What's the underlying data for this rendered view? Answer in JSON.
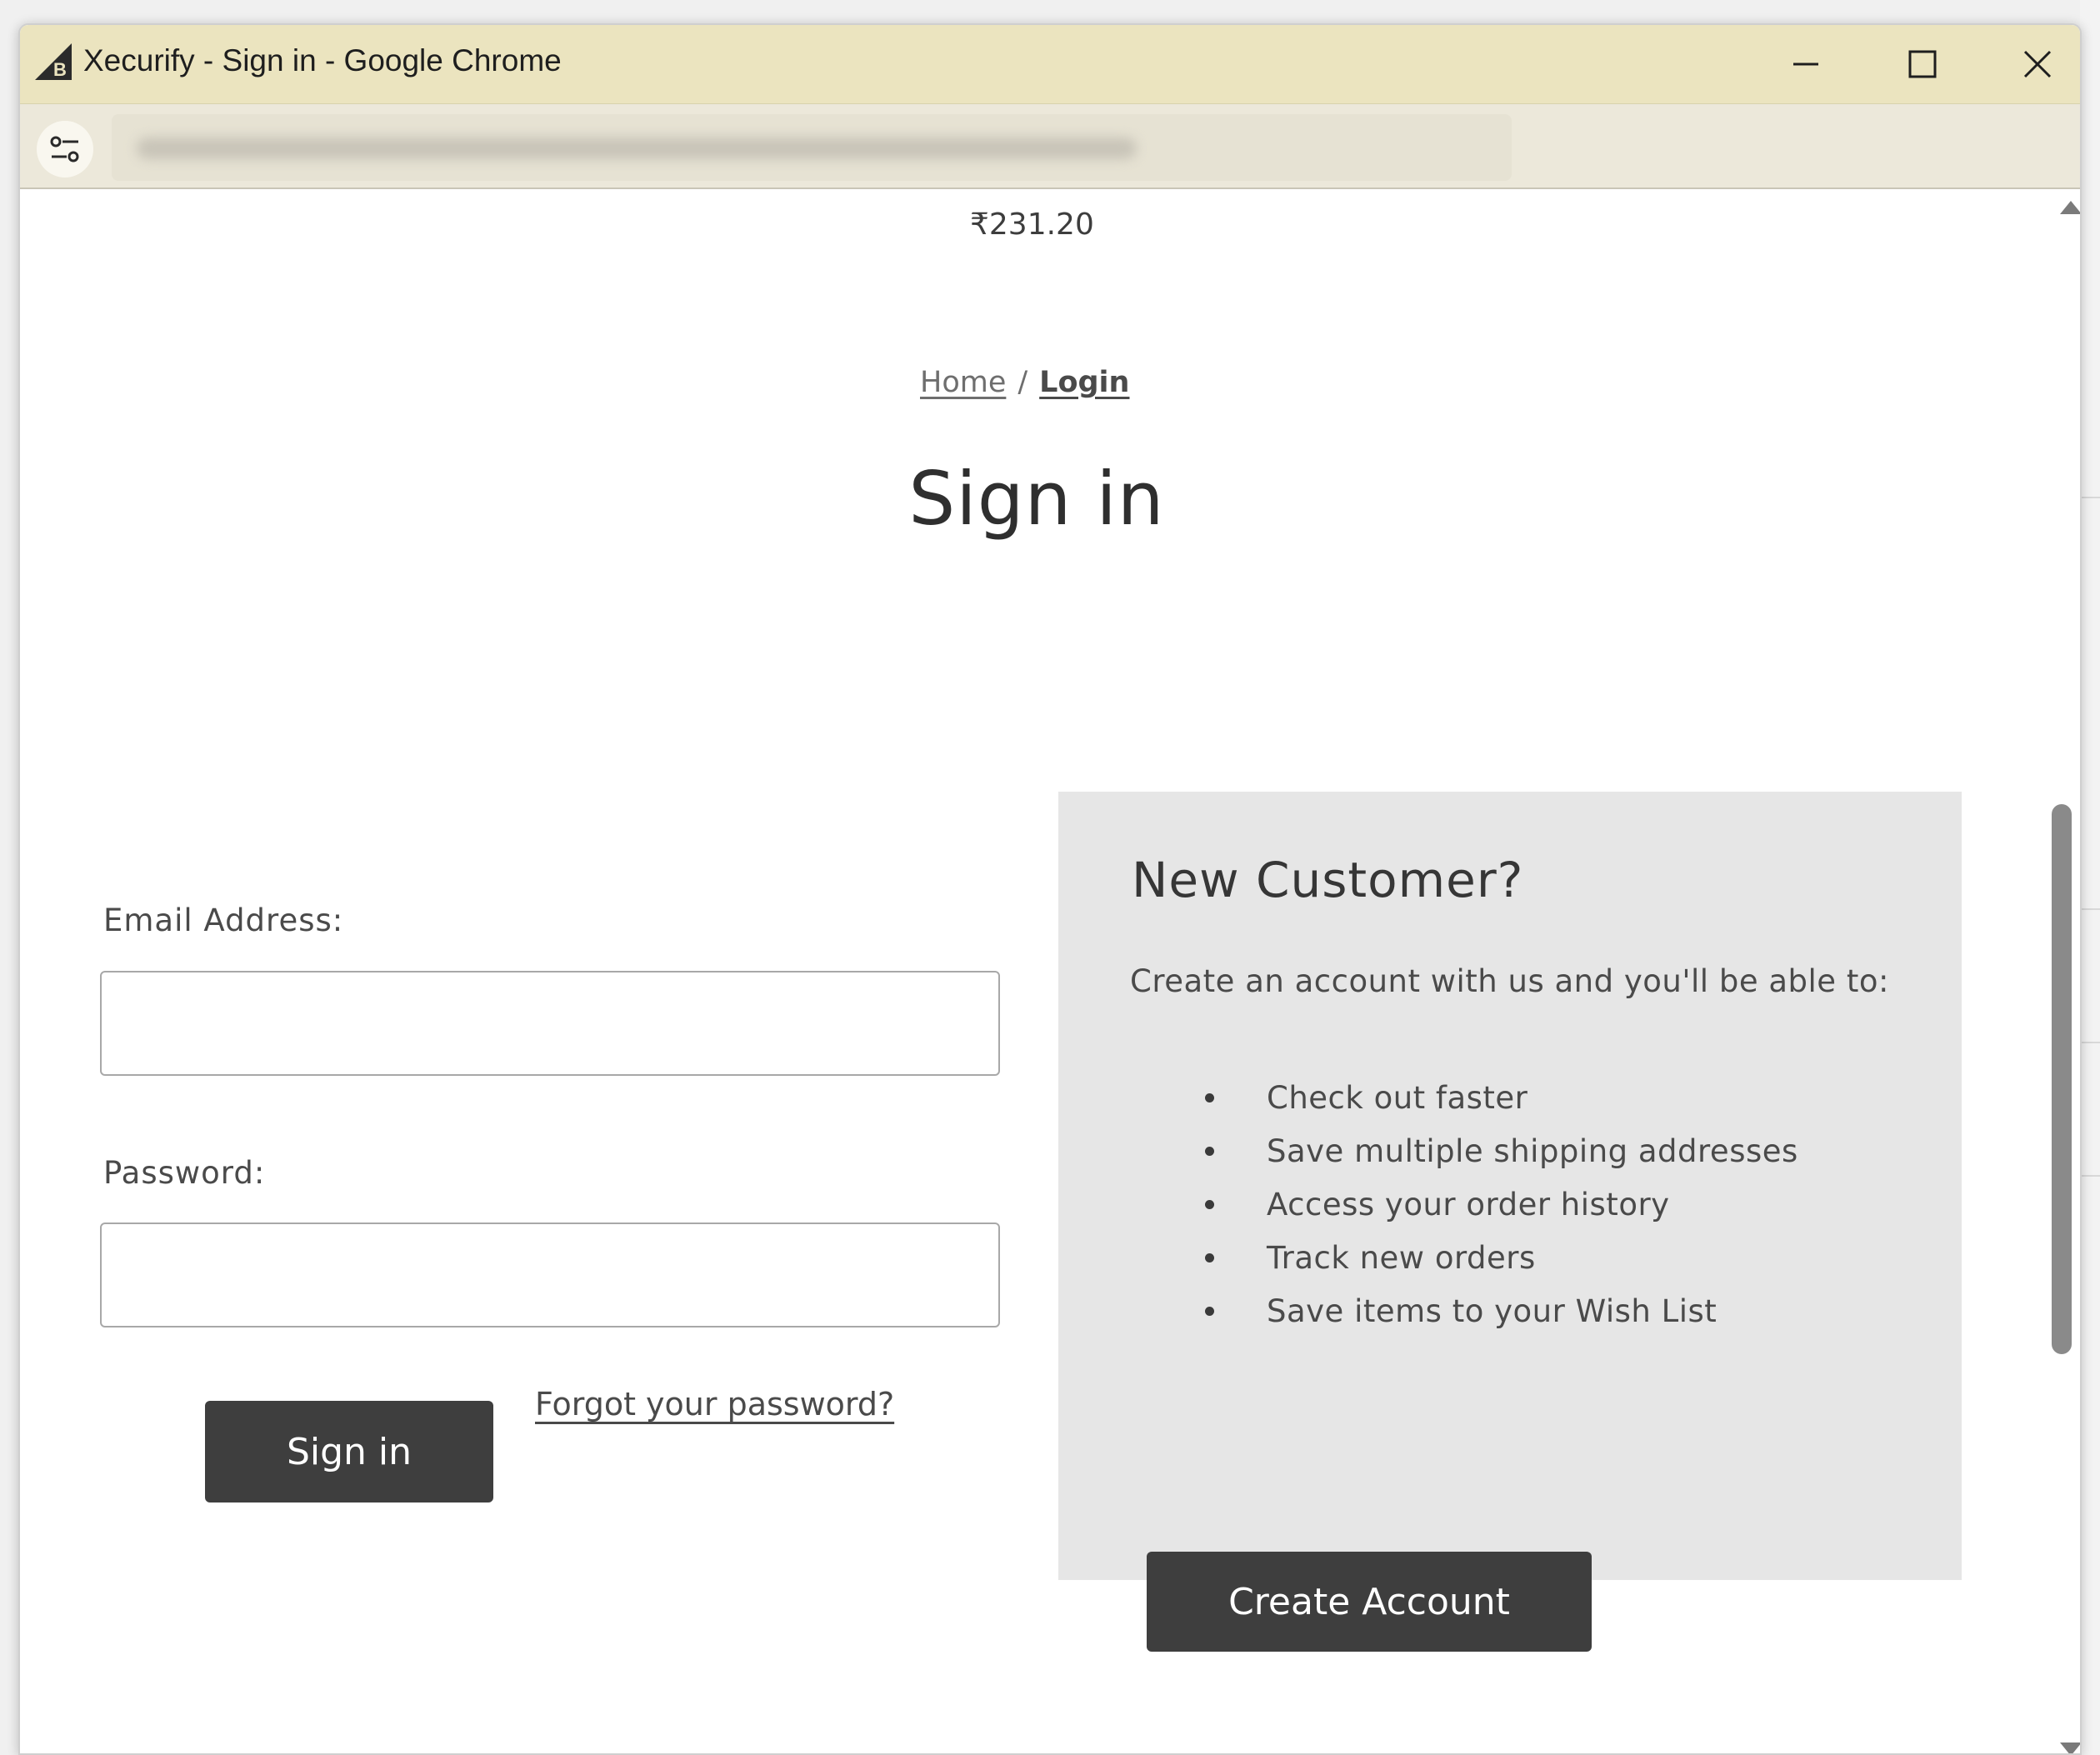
{
  "window": {
    "title": "Xecurify - Sign in - Google Chrome"
  },
  "page": {
    "cart_total": "₹231.20",
    "breadcrumb": {
      "home": "Home",
      "separator": "/",
      "current": "Login"
    },
    "title": "Sign in",
    "form": {
      "email_label": "Email Address:",
      "email_value": "",
      "password_label": "Password:",
      "password_value": "",
      "sign_in_button": "Sign in",
      "forgot_link": "Forgot your password?"
    },
    "new_customer": {
      "heading": "New Customer?",
      "intro": "Create an account with us and you'll be able to:",
      "benefits": [
        "Check out faster",
        "Save multiple shipping addresses",
        "Access your order history",
        "Track new orders",
        "Save items to your Wish List"
      ],
      "create_button": "Create Account"
    }
  },
  "colors": {
    "titlebar": "#ebe4bf",
    "button_dark": "#3e3e3e",
    "panel_bg": "#e6e6e6"
  },
  "icons": {
    "app": "bigcommerce-logo-icon",
    "site_info": "tune-icon",
    "minimize": "minimize-icon",
    "maximize": "maximize-icon",
    "close": "close-icon"
  }
}
